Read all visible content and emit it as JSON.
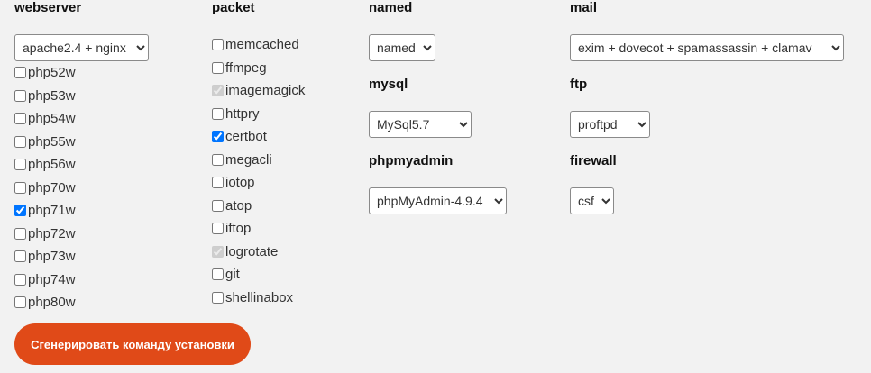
{
  "webserver": {
    "heading": "webserver",
    "select": {
      "selected": "apache2.4 + nginx"
    },
    "php_options": [
      {
        "label": "php52w",
        "checked": false
      },
      {
        "label": "php53w",
        "checked": false
      },
      {
        "label": "php54w",
        "checked": false
      },
      {
        "label": "php55w",
        "checked": false
      },
      {
        "label": "php56w",
        "checked": false
      },
      {
        "label": "php70w",
        "checked": false
      },
      {
        "label": "php71w",
        "checked": true
      },
      {
        "label": "php72w",
        "checked": false
      },
      {
        "label": "php73w",
        "checked": false
      },
      {
        "label": "php74w",
        "checked": false
      },
      {
        "label": "php80w",
        "checked": false
      }
    ]
  },
  "packet": {
    "heading": "packet",
    "items": [
      {
        "label": "memcached",
        "checked": false,
        "disabled": false
      },
      {
        "label": "ffmpeg",
        "checked": false,
        "disabled": false
      },
      {
        "label": "imagemagick",
        "checked": true,
        "disabled": true
      },
      {
        "label": "httpry",
        "checked": false,
        "disabled": false
      },
      {
        "label": "certbot",
        "checked": true,
        "disabled": false
      },
      {
        "label": "megacli",
        "checked": false,
        "disabled": false
      },
      {
        "label": "iotop",
        "checked": false,
        "disabled": false
      },
      {
        "label": "atop",
        "checked": false,
        "disabled": false
      },
      {
        "label": "iftop",
        "checked": false,
        "disabled": false
      },
      {
        "label": "logrotate",
        "checked": true,
        "disabled": true
      },
      {
        "label": "git",
        "checked": false,
        "disabled": false
      },
      {
        "label": "shellinabox",
        "checked": false,
        "disabled": false
      }
    ]
  },
  "named": {
    "heading": "named",
    "selected": "named"
  },
  "mysql": {
    "heading": "mysql",
    "selected": "MySql5.7"
  },
  "phpmyadmin": {
    "heading": "phpmyadmin",
    "selected": "phpMyAdmin-4.9.4"
  },
  "mail": {
    "heading": "mail",
    "selected": "exim + dovecot + spamassassin + clamav"
  },
  "ftp": {
    "heading": "ftp",
    "selected": "proftpd"
  },
  "firewall": {
    "heading": "firewall",
    "selected": "csf"
  },
  "generate_button": {
    "label": "Сгенерировать команду установки"
  },
  "colors": {
    "accent": "#e04a18",
    "background": "#f2f2f2",
    "checkbox_checked": "#1a73e8"
  }
}
